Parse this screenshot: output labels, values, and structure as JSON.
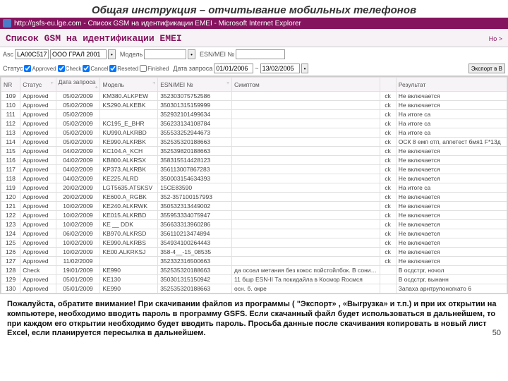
{
  "slide": {
    "title": "Общая инструкция – отчитывание мобильных телефонов",
    "page_number": "50"
  },
  "ie": {
    "title": "http://gsfs-eu.lge.com - Список GSM на идентификации EMEI - Microsoft Internet Explorer"
  },
  "header": {
    "title": "Список GSM на идентификации EMEI",
    "help": "Но >"
  },
  "filter": {
    "asc_label": "Asc",
    "asc_value": "LA00C517",
    "asc_value2": "OOO ГРАЛ 2001",
    "go": "•",
    "model_label": "Модель",
    "esn_label": "ESN/MEI №",
    "status_label": "Статус",
    "status_opts": [
      "Approved",
      "Check",
      "Cancel",
      "Reseted",
      "Finished"
    ],
    "date_label": "Дата запроса",
    "date_from": "01/01/2006",
    "date_to": "13/02/2005",
    "export_btn": "Экспорт в В"
  },
  "columns": [
    "NR",
    "Статус",
    "Дата запроса",
    "Модель",
    "ESN/MEI №",
    "Симптом",
    "",
    "Результат"
  ],
  "rows": [
    {
      "nr": "109",
      "status": "Approved",
      "date": "05/02/2009",
      "model": "KM380.ALKPEW",
      "esn": "352303075752586",
      "sym": "",
      "cb": "ck",
      "res": "Не включается"
    },
    {
      "nr": "110",
      "status": "Approved",
      "date": "05/02/2009",
      "model": "KS290.ALKEBK",
      "esn": "350301315159999",
      "sym": "",
      "cb": "ck",
      "res": "Не включается"
    },
    {
      "nr": "111",
      "status": "Approved",
      "date": "05/02/2009",
      "model": "",
      "esn": "352932101499634",
      "sym": "",
      "cb": "ck",
      "res": "На итоге са"
    },
    {
      "nr": "112",
      "status": "Approved",
      "date": "05/02/2009",
      "model": "KC195_E_BHR",
      "esn": "356233134108784",
      "sym": "",
      "cb": "ck",
      "res": "На итоге са"
    },
    {
      "nr": "113",
      "status": "Approved",
      "date": "05/02/2009",
      "model": "KU990.ALKRBD",
      "esn": "355533252944673",
      "sym": "",
      "cb": "ck",
      "res": "На итоге са"
    },
    {
      "nr": "114",
      "status": "Approved",
      "date": "05/02/2009",
      "model": "KE990.ALKRBK",
      "esn": "352535320188663",
      "sym": "",
      "cb": "ck",
      "res": "ОСК 8 емп отп, аппетест бмя1 F*13д"
    },
    {
      "nr": "115",
      "status": "Approved",
      "date": "04/02/2009",
      "model": "KC104.A_KCH",
      "esn": "352539820188663",
      "sym": "",
      "cb": "ck",
      "res": "Не включается"
    },
    {
      "nr": "116",
      "status": "Approved",
      "date": "04/02/2009",
      "model": "KB800.ALKRSX",
      "esn": "358315514428123",
      "sym": "",
      "cb": "ck",
      "res": "Не включается"
    },
    {
      "nr": "117",
      "status": "Approved",
      "date": "04/02/2009",
      "model": "KP373.ALKRBK",
      "esn": "356113007867283",
      "sym": "",
      "cb": "ck",
      "res": "Не включается"
    },
    {
      "nr": "118",
      "status": "Approved",
      "date": "04/02/2009",
      "model": "KE225.ALRD",
      "esn": "350003154634393",
      "sym": "",
      "cb": "ck",
      "res": "Не включается"
    },
    {
      "nr": "119",
      "status": "Approved",
      "date": "20/02/2009",
      "model": "LGT5635.ATSKSV",
      "esn": "15CE83590",
      "sym": "",
      "cb": "ck",
      "res": "На итоге са"
    },
    {
      "nr": "120",
      "status": "Approved",
      "date": "20/02/2009",
      "model": "KE600.A_RGBK",
      "esn": "352-357100157993",
      "sym": "",
      "cb": "ck",
      "res": "Не включается"
    },
    {
      "nr": "121",
      "status": "Approved",
      "date": "10/02/2009",
      "model": "KE240.ALKRWK",
      "esn": "350532313449002",
      "sym": "",
      "cb": "ck",
      "res": "Не включается"
    },
    {
      "nr": "122",
      "status": "Approved",
      "date": "10/02/2009",
      "model": "KE015.ALKRBD",
      "esn": "355953334075947",
      "sym": "",
      "cb": "ck",
      "res": "Не включается"
    },
    {
      "nr": "123",
      "status": "Approved",
      "date": "10/02/2009",
      "model": "KE __ DDK",
      "esn": "356633313960286",
      "sym": "",
      "cb": "ck",
      "res": "Не включается"
    },
    {
      "nr": "124",
      "status": "Approved",
      "date": "06/02/2009",
      "model": "KB970.ALKRSD",
      "esn": "356110213474894",
      "sym": "",
      "cb": "ck",
      "res": "Не включается"
    },
    {
      "nr": "125",
      "status": "Approved",
      "date": "10/02/2009",
      "model": "KE990.ALKRBS",
      "esn": "354934100264443",
      "sym": "",
      "cb": "ck",
      "res": "Не включается"
    },
    {
      "nr": "126",
      "status": "Approved",
      "date": "10/02/2009",
      "model": "KE00.ALKRKSJ",
      "esn": "358-4__-15_08535",
      "sym": "",
      "cb": "ck",
      "res": "Не включается"
    },
    {
      "nr": "127",
      "status": "Approved",
      "date": "11/02/2009",
      "model": "",
      "esn": "352332316500663",
      "sym": "",
      "cb": "ck",
      "res": "Не включается"
    },
    {
      "nr": "128",
      "status": "Check",
      "date": "19/01/2009",
      "model": "KE990",
      "esn": "352535320188663",
      "sym": "да осоал метания без кокос пойстойлбок. В сони тручан",
      "cb": "",
      "res": "В осдстрг, ночол"
    },
    {
      "nr": "129",
      "status": "Approved",
      "date": "05/01/2009",
      "model": "KE130",
      "esn": "350301315150942",
      "sym": "11 бшр ESN-II Та покидайла в Космор Roсмся",
      "cb": "",
      "res": "В осдстрг, вынанн"
    },
    {
      "nr": "130",
      "status": "Approved",
      "date": "05/01/2009",
      "model": "KE990",
      "esn": "352535320188663",
      "sym": "осн. б. окре",
      "cb": "",
      "res": "Запаха арнтрупоногкато 6"
    }
  ],
  "footer": {
    "text": "Пожалуйста, обратите внимание! При скачивании файлов из программы ( \"Экспорт» , «Выгрузка» и т.п.) и при их открытии на компьютере, необходимо вводить пароль в программу GSFS. Если скачанный файл будет использоваться в дальнейшем, то при каждом его открытии необходимо будет вводить пароль. Просьба данные после скачивания копировать в новый лист Excel, если планируется пересылка в дальнейшем."
  }
}
